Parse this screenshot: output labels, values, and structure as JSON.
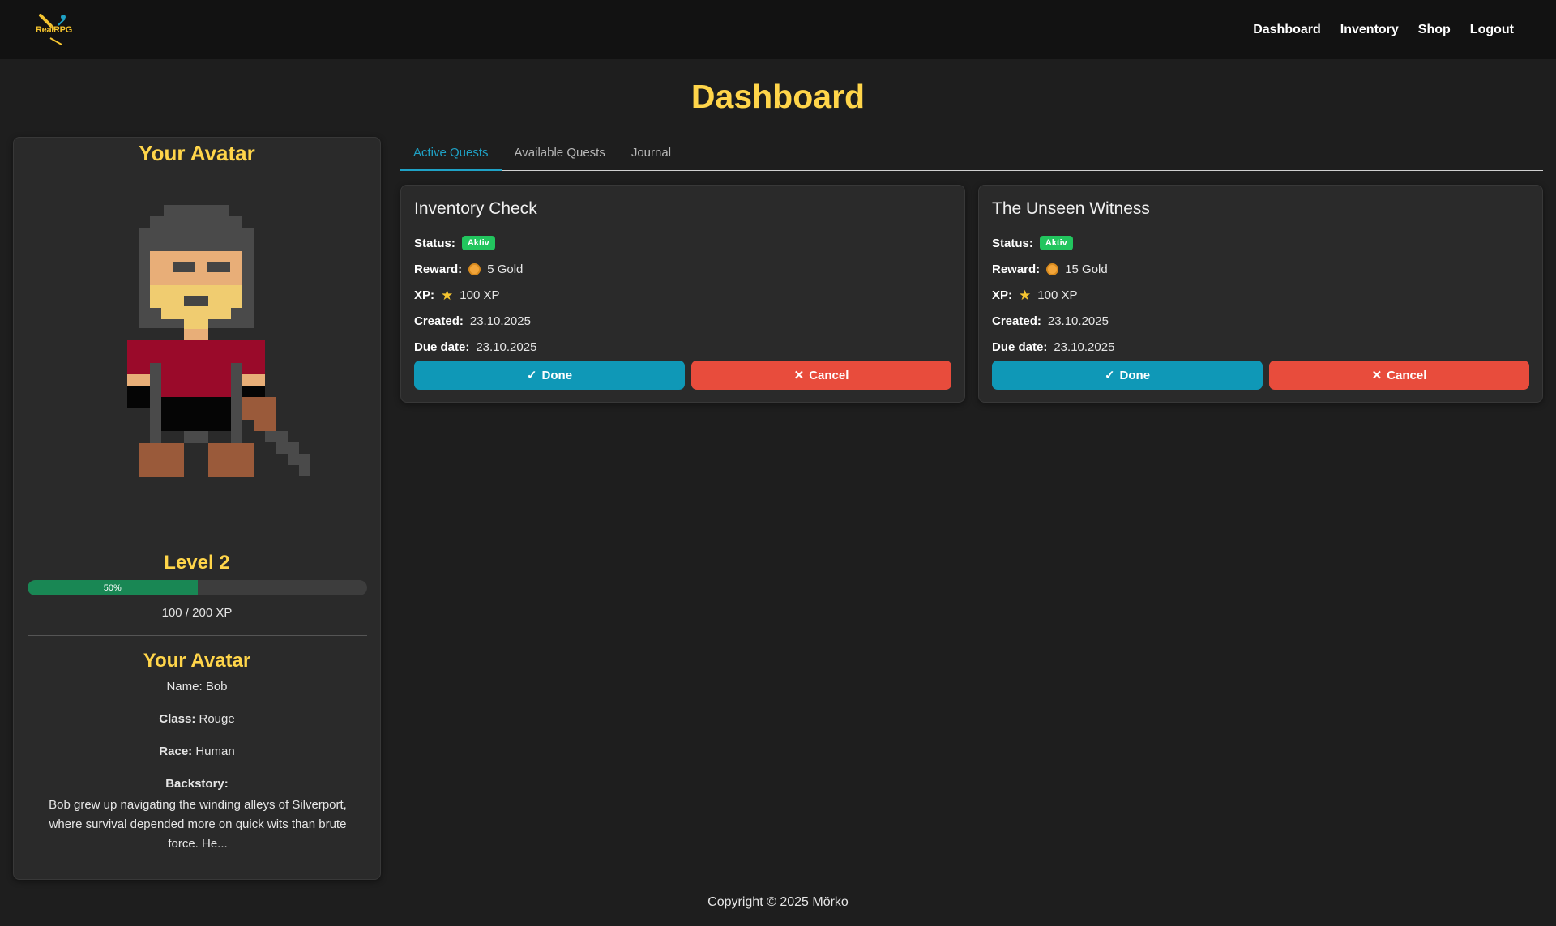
{
  "nav": {
    "logo_text": "RealRPG",
    "links": [
      "Dashboard",
      "Inventory",
      "Shop",
      "Logout"
    ]
  },
  "page": {
    "title": "Dashboard"
  },
  "avatar": {
    "heading": "Your Avatar",
    "level": "Level 2",
    "xp_percent": 50,
    "xp_percent_label": "50%",
    "xp_text": "100 / 200 XP",
    "details_heading": "Your Avatar",
    "name_line": "Name: Bob",
    "class_label": "Class:",
    "class_value": "Rouge",
    "race_label": "Race:",
    "race_value": "Human",
    "backstory_label": "Backstory:",
    "backstory": "Bob grew up navigating the winding alleys of Silverport, where survival depended more on quick wits than brute force. He..."
  },
  "tabs": [
    "Active Quests",
    "Available Quests",
    "Journal"
  ],
  "labels": {
    "status": "Status:",
    "reward": "Reward:",
    "xp": "XP:",
    "created": "Created:",
    "due": "Due date:",
    "done": "Done",
    "cancel": "Cancel"
  },
  "quests": [
    {
      "title": "Inventory Check",
      "status": "Aktiv",
      "reward": "5 Gold",
      "xp": "100 XP",
      "created": "23.10.2025",
      "due": "23.10.2025"
    },
    {
      "title": "The Unseen Witness",
      "status": "Aktiv",
      "reward": "15 Gold",
      "xp": "100 XP",
      "created": "23.10.2025",
      "due": "23.10.2025"
    }
  ],
  "footer": {
    "text": "Copyright © 2025 Mörko"
  },
  "colors": {
    "accent_yellow": "#ffd54a",
    "tab_active": "#1fa2c6",
    "done_button": "#0f98b7",
    "cancel_button": "#e84c3c",
    "status_badge": "#22c55e",
    "xp_fill": "#198754"
  }
}
